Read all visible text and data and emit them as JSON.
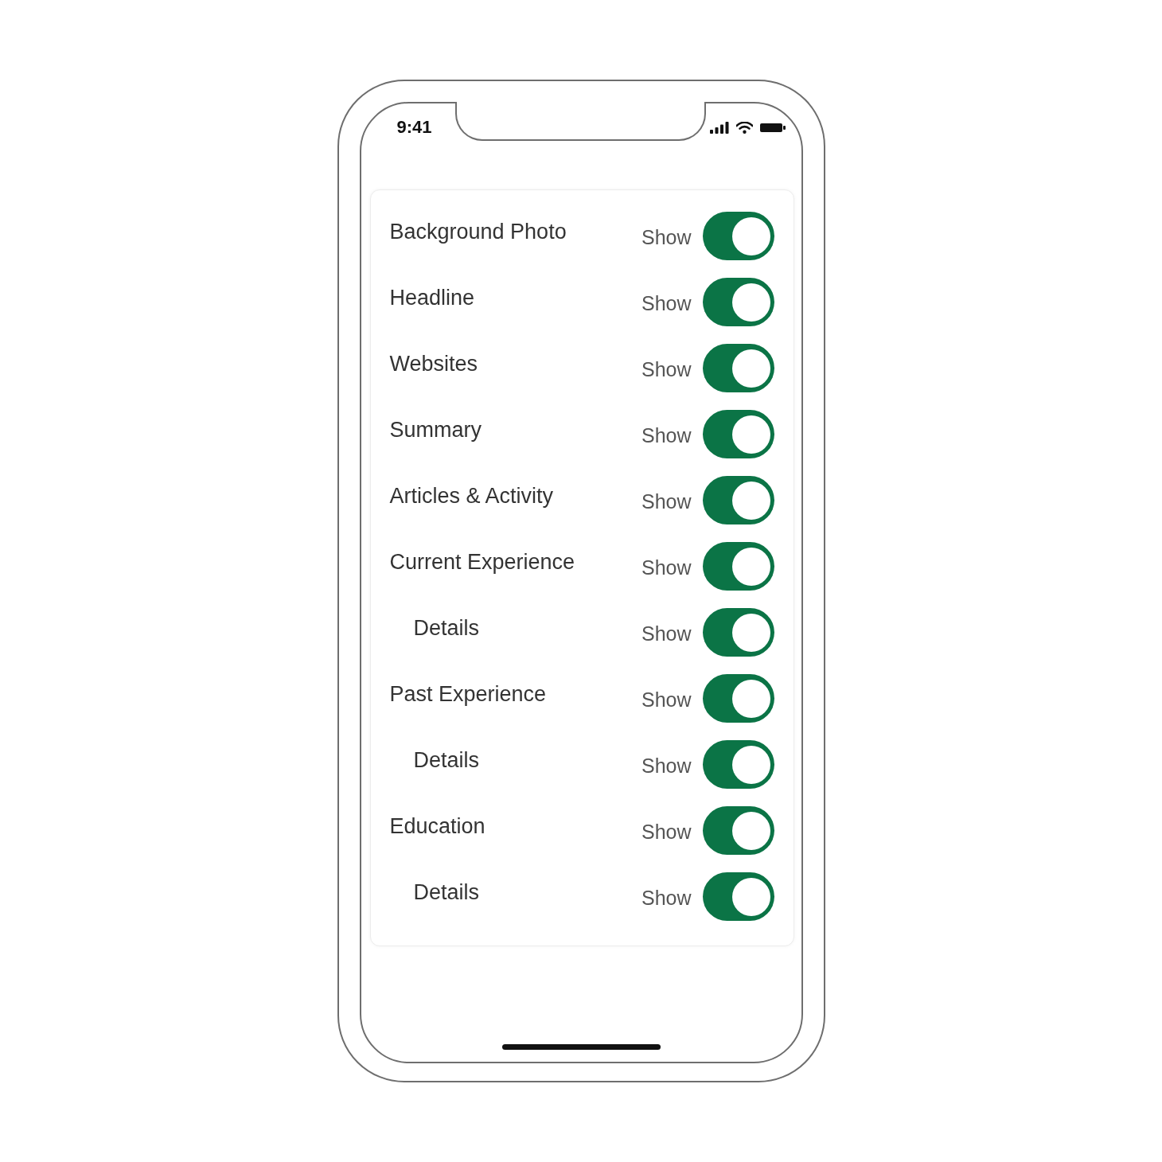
{
  "status_bar": {
    "time": "9:41"
  },
  "settings": [
    {
      "label": "Background Photo",
      "toggle_label": "Show",
      "on": true
    },
    {
      "label": "Headline",
      "toggle_label": "Show",
      "on": true
    },
    {
      "label": "Websites",
      "toggle_label": "Show",
      "on": true
    },
    {
      "label": "Summary",
      "toggle_label": "Show",
      "on": true
    },
    {
      "label": "Articles & Activity",
      "toggle_label": "Show",
      "on": true
    },
    {
      "label": "Current Experience",
      "toggle_label": "Show",
      "on": true,
      "children": [
        {
          "label": "Details",
          "toggle_label": "Show",
          "on": true
        }
      ]
    },
    {
      "label": "Past Experience",
      "toggle_label": "Show",
      "on": true,
      "children": [
        {
          "label": "Details",
          "toggle_label": "Show",
          "on": true
        }
      ]
    },
    {
      "label": "Education",
      "toggle_label": "Show",
      "on": true,
      "children": [
        {
          "label": "Details",
          "toggle_label": "Show",
          "on": true
        }
      ]
    }
  ]
}
